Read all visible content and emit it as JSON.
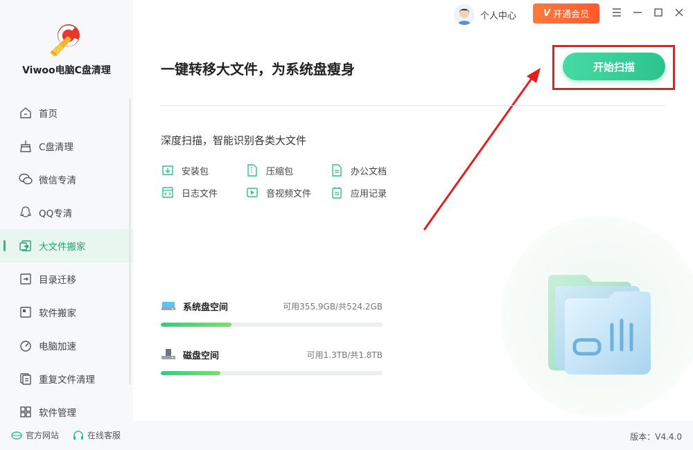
{
  "app": {
    "title": "Viwoo电脑C盘清理",
    "version_label": "版本：V4.4.0"
  },
  "topbar": {
    "profile_label": "个人中心",
    "vip_label": "开通会员",
    "vip_mark": "V"
  },
  "sidebar": {
    "items": [
      {
        "label": "首页",
        "icon": "home-icon"
      },
      {
        "label": "C盘清理",
        "icon": "broom-icon"
      },
      {
        "label": "微信专清",
        "icon": "wechat-icon"
      },
      {
        "label": "QQ专清",
        "icon": "qq-icon"
      },
      {
        "label": "大文件搬家",
        "icon": "file-move-icon"
      },
      {
        "label": "目录迁移",
        "icon": "folder-move-icon"
      },
      {
        "label": "软件搬家",
        "icon": "software-move-icon"
      },
      {
        "label": "电脑加速",
        "icon": "speed-icon"
      },
      {
        "label": "重复文件清理",
        "icon": "duplicate-icon"
      },
      {
        "label": "软件管理",
        "icon": "apps-icon"
      }
    ],
    "active_index": 4
  },
  "footer": {
    "website_label": "官方网站",
    "service_label": "在线客服"
  },
  "main": {
    "title": "一键转移大文件，为系统盘瘦身",
    "scan_button": "开始扫描",
    "subtitle": "深度扫描，智能识别各类大文件",
    "file_types": [
      {
        "label": "安装包",
        "icon": "package-icon"
      },
      {
        "label": "压缩包",
        "icon": "zip-icon"
      },
      {
        "label": "办公文档",
        "icon": "document-icon"
      },
      {
        "label": "日志文件",
        "icon": "log-icon"
      },
      {
        "label": "音视频文件",
        "icon": "media-icon"
      },
      {
        "label": "应用记录",
        "icon": "app-record-icon"
      }
    ],
    "disks": [
      {
        "name": "系统盘空间",
        "info": "可用355.9GB/共524.2GB",
        "used_fraction": 0.32
      },
      {
        "name": "磁盘空间",
        "info": "可用1.3TB/共1.8TB",
        "used_fraction": 0.27
      }
    ]
  },
  "colors": {
    "accent": "#2cc48c",
    "highlight": "#e81d1d",
    "vip": "#ff5a2c"
  }
}
